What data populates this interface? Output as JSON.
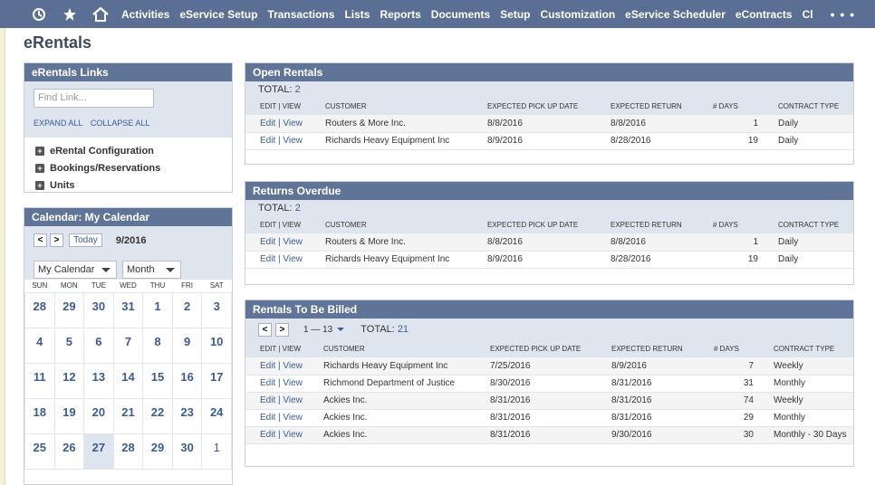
{
  "nav": {
    "icons": [
      "recent-icon",
      "star-icon",
      "home-icon"
    ],
    "items": [
      "Activities",
      "eService Setup",
      "Transactions",
      "Lists",
      "Reports",
      "Documents",
      "Setup",
      "Customization",
      "eService Scheduler",
      "eContracts",
      "Cl"
    ],
    "more": "• • •"
  },
  "page_title": "eRentals",
  "links_portlet": {
    "title": "eRentals Links",
    "find_placeholder": "Find Link...",
    "expand_all": "EXPAND ALL",
    "collapse_all": "COLLAPSE ALL",
    "items": [
      "eRental Configuration",
      "Bookings/Reservations",
      "Units"
    ]
  },
  "calendar": {
    "title": "Calendar: My Calendar",
    "prev": "<",
    "next": ">",
    "today_label": "Today",
    "month_label": "9/2016",
    "calendar_select": "My Calendar",
    "view_select": "Month",
    "weekdays": [
      "SUN",
      "MON",
      "TUE",
      "WED",
      "THU",
      "FRI",
      "SAT"
    ],
    "weeks": [
      [
        "28",
        "29",
        "30",
        "31",
        "1",
        "2",
        "3"
      ],
      [
        "4",
        "5",
        "6",
        "7",
        "8",
        "9",
        "10"
      ],
      [
        "11",
        "12",
        "13",
        "14",
        "15",
        "16",
        "17"
      ],
      [
        "18",
        "19",
        "20",
        "21",
        "22",
        "23",
        "24"
      ],
      [
        "25",
        "26",
        "27",
        "28",
        "29",
        "30",
        "1"
      ]
    ],
    "today": "27"
  },
  "columns": [
    "EDIT | VIEW",
    "CUSTOMER",
    "EXPECTED PICK UP DATE",
    "EXPECTED RETURN",
    "# DAYS",
    "CONTRACT TYPE"
  ],
  "edit_label": "Edit",
  "view_label": "View",
  "open_rentals": {
    "title": "Open Rentals",
    "total_label": "TOTAL:",
    "total": "2",
    "rows": [
      {
        "customer": "Routers & More Inc.",
        "pickup": "8/8/2016",
        "return": "8/8/2016",
        "days": "1",
        "type": "Daily"
      },
      {
        "customer": "Richards Heavy Equipment Inc",
        "pickup": "8/9/2016",
        "return": "8/28/2016",
        "days": "19",
        "type": "Daily"
      }
    ]
  },
  "returns_overdue": {
    "title": "Returns Overdue",
    "total_label": "TOTAL:",
    "total": "2",
    "rows": [
      {
        "customer": "Routers & More Inc.",
        "pickup": "8/8/2016",
        "return": "8/8/2016",
        "days": "1",
        "type": "Daily"
      },
      {
        "customer": "Richards Heavy Equipment Inc",
        "pickup": "8/9/2016",
        "return": "8/28/2016",
        "days": "19",
        "type": "Daily"
      }
    ]
  },
  "to_be_billed": {
    "title": "Rentals To Be Billed",
    "range": "1 — 13",
    "total_label": "TOTAL:",
    "total": "21",
    "rows": [
      {
        "customer": "Richards Heavy Equipment Inc",
        "pickup": "7/25/2016",
        "return": "8/9/2016",
        "days": "7",
        "type": "Weekly"
      },
      {
        "customer": "Richmond Department of Justice",
        "pickup": "8/30/2016",
        "return": "8/31/2016",
        "days": "31",
        "type": "Monthly"
      },
      {
        "customer": "Ackies Inc.",
        "pickup": "8/31/2016",
        "return": "8/31/2016",
        "days": "74",
        "type": "Weekly"
      },
      {
        "customer": "Ackies Inc.",
        "pickup": "8/31/2016",
        "return": "8/31/2016",
        "days": "29",
        "type": "Monthly"
      },
      {
        "customer": "Ackies Inc.",
        "pickup": "8/31/2016",
        "return": "9/30/2016",
        "days": "30",
        "type": "Monthly - 30 Days"
      }
    ]
  }
}
